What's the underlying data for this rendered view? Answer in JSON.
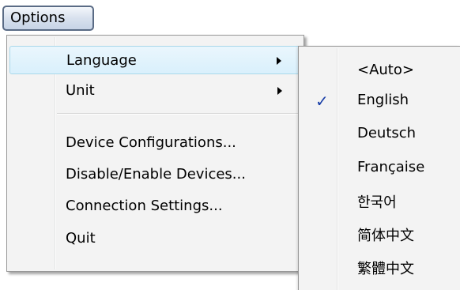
{
  "menubar": {
    "options_label": "Options"
  },
  "main_menu": {
    "items": [
      {
        "label": "Language",
        "submenu": true,
        "highlighted": true
      },
      {
        "label": "Unit",
        "submenu": true
      },
      {
        "label": "Device Configurations..."
      },
      {
        "label": "Disable/Enable Devices..."
      },
      {
        "label": "Connection Settings..."
      },
      {
        "label": "Quit"
      }
    ]
  },
  "language_menu": {
    "items": [
      {
        "label": "<Auto>"
      },
      {
        "label": "English",
        "checked": true
      },
      {
        "label": "Deutsch"
      },
      {
        "label": "Française"
      },
      {
        "label": "한국어"
      },
      {
        "label": "简体中文"
      },
      {
        "label": "繁體中文"
      }
    ],
    "check_glyph": "✓"
  }
}
